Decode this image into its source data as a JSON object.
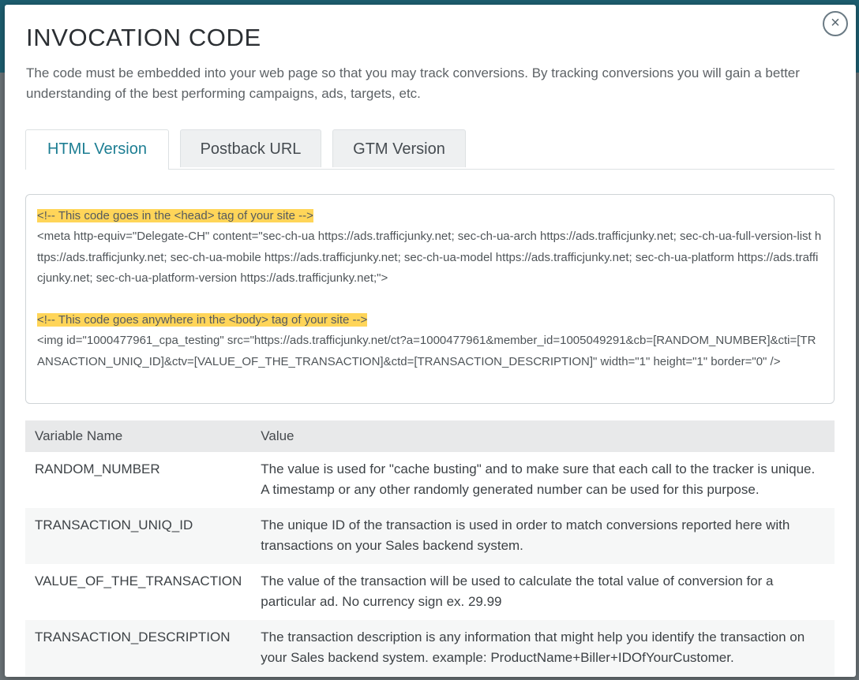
{
  "modal": {
    "title": "INVOCATION CODE",
    "close_symbol": "×",
    "intro": "The code must be embedded into your web page so that you may track conversions. By tracking conversions you will gain a better understanding of the best performing campaigns, ads, targets, etc."
  },
  "tabs": [
    {
      "label": "HTML Version",
      "active": true
    },
    {
      "label": "Postback URL",
      "active": false
    },
    {
      "label": "GTM Version",
      "active": false
    }
  ],
  "code": {
    "head_comment": "<!-- This code goes in the <head> tag of your site -->",
    "head_code": "<meta http-equiv=\"Delegate-CH\" content=\"sec-ch-ua https://ads.trafficjunky.net; sec-ch-ua-arch https://ads.trafficjunky.net; sec-ch-ua-full-version-list https://ads.trafficjunky.net; sec-ch-ua-mobile https://ads.trafficjunky.net; sec-ch-ua-model https://ads.trafficjunky.net; sec-ch-ua-platform https://ads.trafficjunky.net; sec-ch-ua-platform-version https://ads.trafficjunky.net;\">",
    "body_comment": "<!-- This code goes anywhere in the <body> tag of your site -->",
    "body_code": "<img id=\"1000477961_cpa_testing\" src=\"https://ads.trafficjunky.net/ct?a=1000477961&member_id=1005049291&cb=[RANDOM_NUMBER]&cti=[TRANSACTION_UNIQ_ID]&ctv=[VALUE_OF_THE_TRANSACTION]&ctd=[TRANSACTION_DESCRIPTION]\" width=\"1\" height=\"1\" border=\"0\" />"
  },
  "variables": {
    "headers": {
      "name": "Variable Name",
      "value": "Value"
    },
    "rows": [
      {
        "name": "RANDOM_NUMBER",
        "value": "The value is used for \"cache busting\" and to make sure that each call to the tracker is unique. A timestamp or any other randomly generated number can be used for this purpose."
      },
      {
        "name": "TRANSACTION_UNIQ_ID",
        "value": "The unique ID of the transaction is used in order to match conversions reported here with transactions on your Sales backend system."
      },
      {
        "name": "VALUE_OF_THE_TRANSACTION",
        "value": "The value of the transaction will be used to calculate the total value of conversion for a particular ad. No currency sign ex. 29.99"
      },
      {
        "name": "TRANSACTION_DESCRIPTION",
        "value": "The transaction description is any information that might help you identify the transaction on your Sales backend system. example: ProductName+Biller+IDOfYourCustomer."
      }
    ]
  },
  "colors": {
    "accent": "#1d7e93",
    "comment_highlight": "#ffd559",
    "backdrop": "#6b7377"
  }
}
